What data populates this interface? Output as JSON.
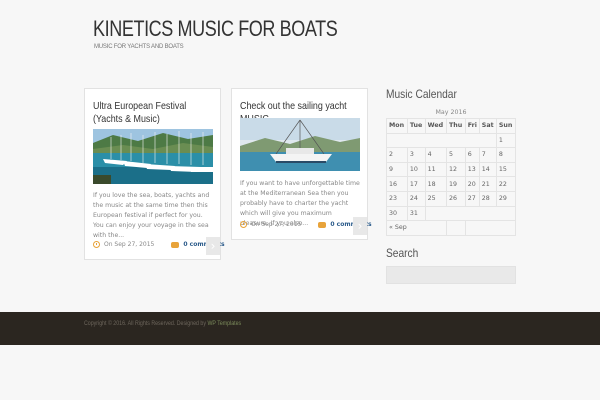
{
  "site": {
    "title": "KINETICS MUSIC FOR BOATS",
    "tagline": "MUSIC FOR YACHTS AND BOATS"
  },
  "posts": [
    {
      "title": "Ultra European Festival (Yachts & Music)",
      "excerpt": "If you love the sea, boats, yachts and the music at the same time then this European festival if perfect for you. You can enjoy your voyage in the sea with the...",
      "date": "On Sep 27, 2015",
      "comments": "0 comments",
      "more": "›"
    },
    {
      "title": "Check out the sailing yacht MUSIC",
      "excerpt": "If you want to have unforgettable time at the Mediterranean Sea then you probably have to charter the yacht which will give you maximum pleasure. If you also...",
      "date": "On Sep 27, 2015",
      "comments": "0 comments",
      "more": "›"
    }
  ],
  "calendar": {
    "title": "Music Calendar",
    "caption": "May 2016",
    "weekdays": [
      "Mon",
      "Tue",
      "Wed",
      "Thu",
      "Fri",
      "Sat",
      "Sun"
    ],
    "weeks": [
      [
        "",
        "",
        "",
        "",
        "",
        "",
        "1"
      ],
      [
        "2",
        "3",
        "4",
        "5",
        "6",
        "7",
        "8"
      ],
      [
        "9",
        "10",
        "11",
        "12",
        "13",
        "14",
        "15"
      ],
      [
        "16",
        "17",
        "18",
        "19",
        "20",
        "21",
        "22"
      ],
      [
        "23",
        "24",
        "25",
        "26",
        "27",
        "28",
        "29"
      ],
      [
        "30",
        "31",
        "",
        "",
        "",
        "",
        ""
      ]
    ],
    "prev_link": "« Sep"
  },
  "search": {
    "title": "Search",
    "placeholder": ""
  },
  "footer": {
    "copyright": "Copyright © 2016. All Rights Reserved. Designed by ",
    "designer_link": "WP Templates"
  },
  "colors": {
    "accent": "#e8a33a",
    "footer_bg": "#2b2620",
    "link": "#2a5a8a"
  }
}
